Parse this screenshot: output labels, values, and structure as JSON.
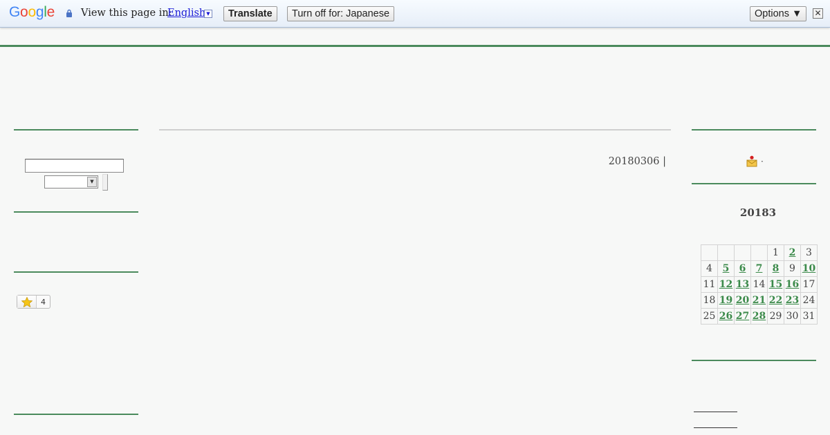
{
  "translate_bar": {
    "logo": "Google",
    "view_text": "View this page in:",
    "language": "English",
    "language_arrow": "▼",
    "translate_label": "Translate",
    "turn_off_label": "Turn off for: Japanese",
    "options_label": "Options ▼",
    "close_label": "✕"
  },
  "main": {
    "date_text": "20180306 |"
  },
  "sidebar_left": {
    "star_count": "4"
  },
  "sidebar_right": {
    "mail_suffix": "·",
    "calendar_title": "20183",
    "calendar_rows": [
      [
        {
          "t": ""
        },
        {
          "t": ""
        },
        {
          "t": ""
        },
        {
          "t": ""
        },
        {
          "t": "1"
        },
        {
          "t": "2",
          "link": true
        },
        {
          "t": "3"
        }
      ],
      [
        {
          "t": "4"
        },
        {
          "t": "5",
          "link": true
        },
        {
          "t": "6",
          "link": true
        },
        {
          "t": "7",
          "link": true
        },
        {
          "t": "8",
          "link": true
        },
        {
          "t": "9"
        },
        {
          "t": "10",
          "link": true
        }
      ],
      [
        {
          "t": "11"
        },
        {
          "t": "12",
          "link": true
        },
        {
          "t": "13",
          "link": true
        },
        {
          "t": "14"
        },
        {
          "t": "15",
          "link": true
        },
        {
          "t": "16",
          "link": true
        },
        {
          "t": "17"
        }
      ],
      [
        {
          "t": "18"
        },
        {
          "t": "19",
          "link": true
        },
        {
          "t": "20",
          "link": true
        },
        {
          "t": "21",
          "link": true
        },
        {
          "t": "22",
          "link": true
        },
        {
          "t": "23",
          "link": true
        },
        {
          "t": "24"
        }
      ],
      [
        {
          "t": "25"
        },
        {
          "t": "26",
          "link": true
        },
        {
          "t": "27",
          "link": true
        },
        {
          "t": "28",
          "link": true
        },
        {
          "t": "29"
        },
        {
          "t": "30"
        },
        {
          "t": "31"
        }
      ]
    ]
  },
  "colors": {
    "accent_green": "#4a8a5c",
    "link_green": "#3b8a4a",
    "link_blue": "#1a1ad6"
  }
}
